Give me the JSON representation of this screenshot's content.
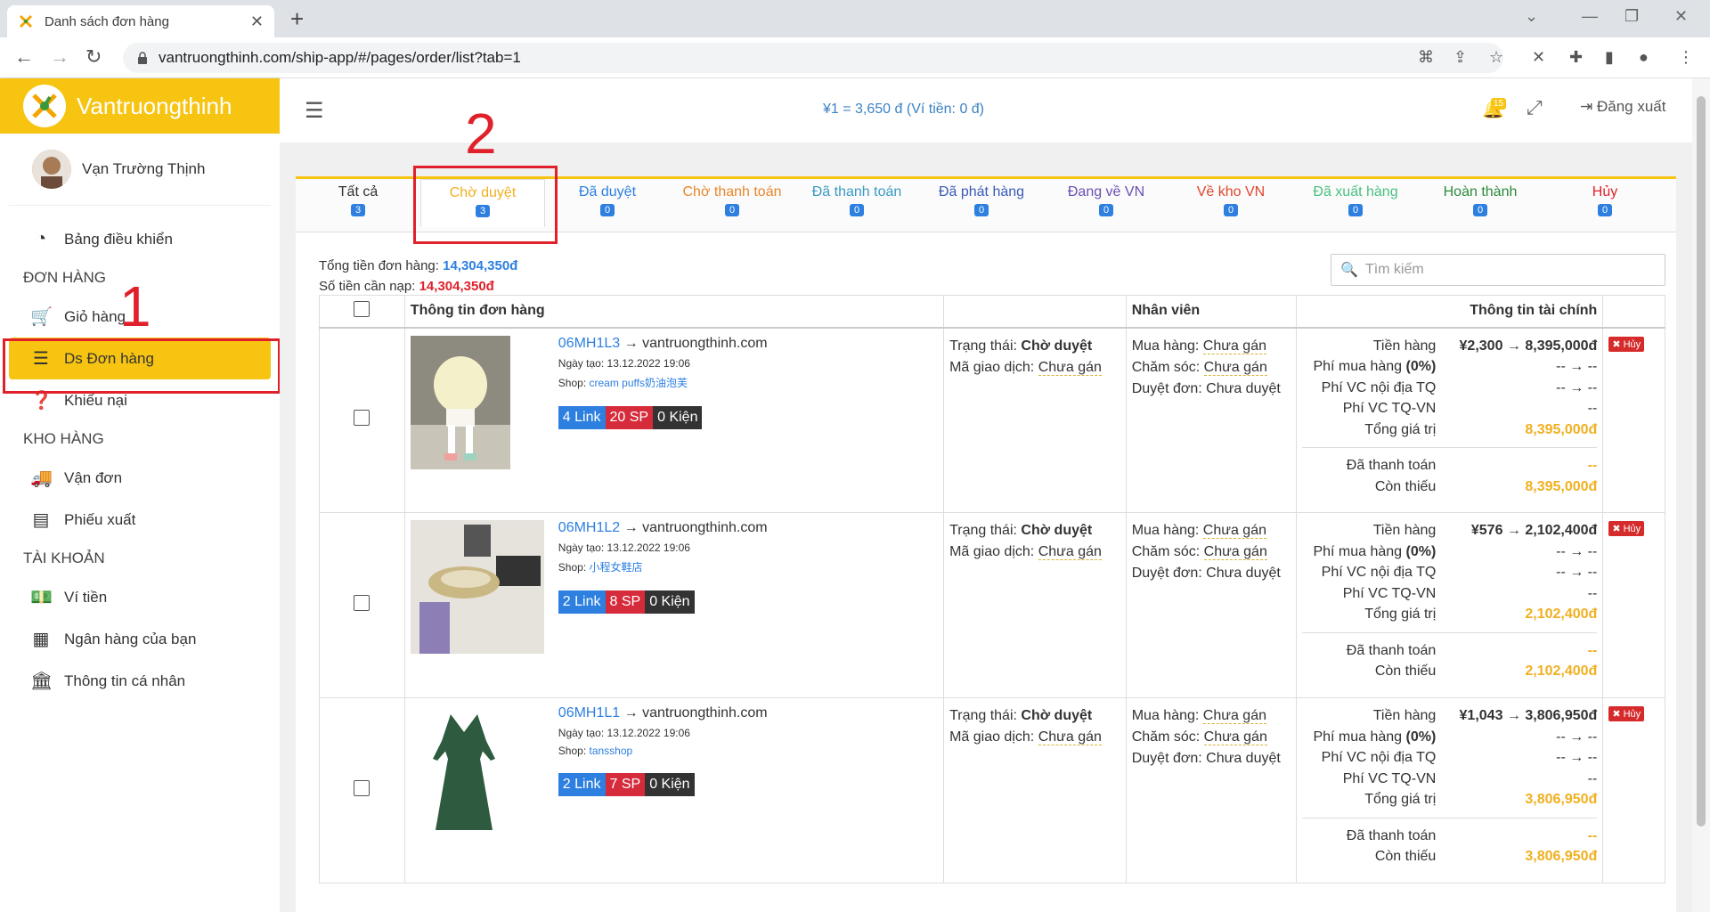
{
  "browser": {
    "tab_title": "Danh sách đơn hàng",
    "url": "vantruongthinh.com/ship-app/#/pages/order/list?tab=1"
  },
  "sidebar": {
    "brand": "Vantruongthinh",
    "user_name": "Vạn Trường Thịnh",
    "items": [
      {
        "label": "Bảng điều khiển",
        "icon": "dashboard-icon"
      },
      {
        "section": "ĐƠN HÀNG"
      },
      {
        "label": "Giỏ hàng",
        "icon": "cart-icon"
      },
      {
        "label": "Ds Đơn hàng",
        "icon": "list-icon",
        "active": true
      },
      {
        "label": "Khiếu nại",
        "icon": "question-icon"
      },
      {
        "section": "KHO HÀNG"
      },
      {
        "label": "Vận đơn",
        "icon": "truck-icon"
      },
      {
        "label": "Phiếu xuất",
        "icon": "receipt-icon"
      },
      {
        "section": "TÀI KHOẢN"
      },
      {
        "label": "Ví tiền",
        "icon": "money-icon"
      },
      {
        "label": "Ngân hàng của bạn",
        "icon": "calendar-icon"
      },
      {
        "label": "Thông tin cá nhân",
        "icon": "bank-icon"
      }
    ]
  },
  "annotations": {
    "step1": "1",
    "step2": "2"
  },
  "header": {
    "rate": "¥1 = 3,650 đ (Ví tiền: 0 đ)",
    "notif_count": "15",
    "logout": "Đăng xuất"
  },
  "status_tabs": [
    {
      "label": "Tất cả",
      "count": "3",
      "color": "#333333"
    },
    {
      "label": "Chờ duyệt",
      "count": "3",
      "color": "#f0b020",
      "selected": true
    },
    {
      "label": "Đã duyệt",
      "count": "0",
      "color": "#2d7fe0"
    },
    {
      "label": "Chờ thanh toán",
      "count": "0",
      "color": "#e8862a"
    },
    {
      "label": "Đã thanh toán",
      "count": "0",
      "color": "#3b9ac4"
    },
    {
      "label": "Đã phát hàng",
      "count": "0",
      "color": "#3a5bb8"
    },
    {
      "label": "Đang về VN",
      "count": "0",
      "color": "#6a4fb3"
    },
    {
      "label": "Về kho VN",
      "count": "0",
      "color": "#e0452b"
    },
    {
      "label": "Đã xuất hàng",
      "count": "0",
      "color": "#48c080"
    },
    {
      "label": "Hoàn thành",
      "count": "0",
      "color": "#2a8a3a"
    },
    {
      "label": "Hủy",
      "count": "0",
      "color": "#e0212b"
    }
  ],
  "summary": {
    "total_label": "Tổng tiền đơn hàng:",
    "total_value": "14,304,350đ",
    "topup_label": "Số tiền cần nạp:",
    "topup_value": "14,304,350đ"
  },
  "search": {
    "placeholder": "Tìm kiếm"
  },
  "table": {
    "headers": [
      "Thông tin đơn hàng",
      "",
      "Nhân viên",
      "Thông tin tài chính",
      ""
    ],
    "labels": {
      "created": "Ngày tạo:",
      "shop": "Shop:",
      "status": "Trạng thái:",
      "txn": "Mã giao dịch:",
      "unassigned": "Chưa gán",
      "buyer": "Mua hàng:",
      "care": "Chăm sóc:",
      "approve": "Duyệt đơn:",
      "not_approved": "Chưa duyệt",
      "goods": "Tiền hàng",
      "fee": "Phí mua hàng",
      "fee_pct": "(0%)",
      "domestic": "Phí VC nội địa TQ",
      "intl": "Phí VC TQ-VN",
      "total": "Tổng giá trị",
      "paid": "Đã thanh toán",
      "remaining": "Còn thiếu",
      "cancel": "Hủy",
      "arrow_dash": "-- → --",
      "dash": "--"
    },
    "rows": [
      {
        "code": "06MH1L3",
        "site": "→ vantruongthinh.com",
        "created": "13.12.2022 19:06",
        "shop": "cream puffs奶油泡芙",
        "links": "4 Link",
        "sp": "20 SP",
        "kien": "0 Kiện",
        "status": "Chờ duyệt",
        "goods": "¥2,300 → 8,395,000đ",
        "total": "8,395,000đ",
        "remaining": "8,395,000đ",
        "thumb": "jacket"
      },
      {
        "code": "06MH1L2",
        "site": "→ vantruongthinh.com",
        "created": "13.12.2022 19:06",
        "shop": "小程女鞋店",
        "links": "2 Link",
        "sp": "8 SP",
        "kien": "0 Kiện",
        "status": "Chờ duyệt",
        "goods": "¥576 → 2,102,400đ",
        "total": "2,102,400đ",
        "remaining": "2,102,400đ",
        "thumb": "shoe"
      },
      {
        "code": "06MH1L1",
        "site": "→ vantruongthinh.com",
        "created": "13.12.2022 19:06",
        "shop": "tansshop",
        "links": "2 Link",
        "sp": "7 SP",
        "kien": "0 Kiện",
        "status": "Chờ duyệt",
        "goods": "¥1,043 → 3,806,950đ",
        "total": "3,806,950đ",
        "remaining": "3,806,950đ",
        "thumb": "dress"
      }
    ]
  }
}
